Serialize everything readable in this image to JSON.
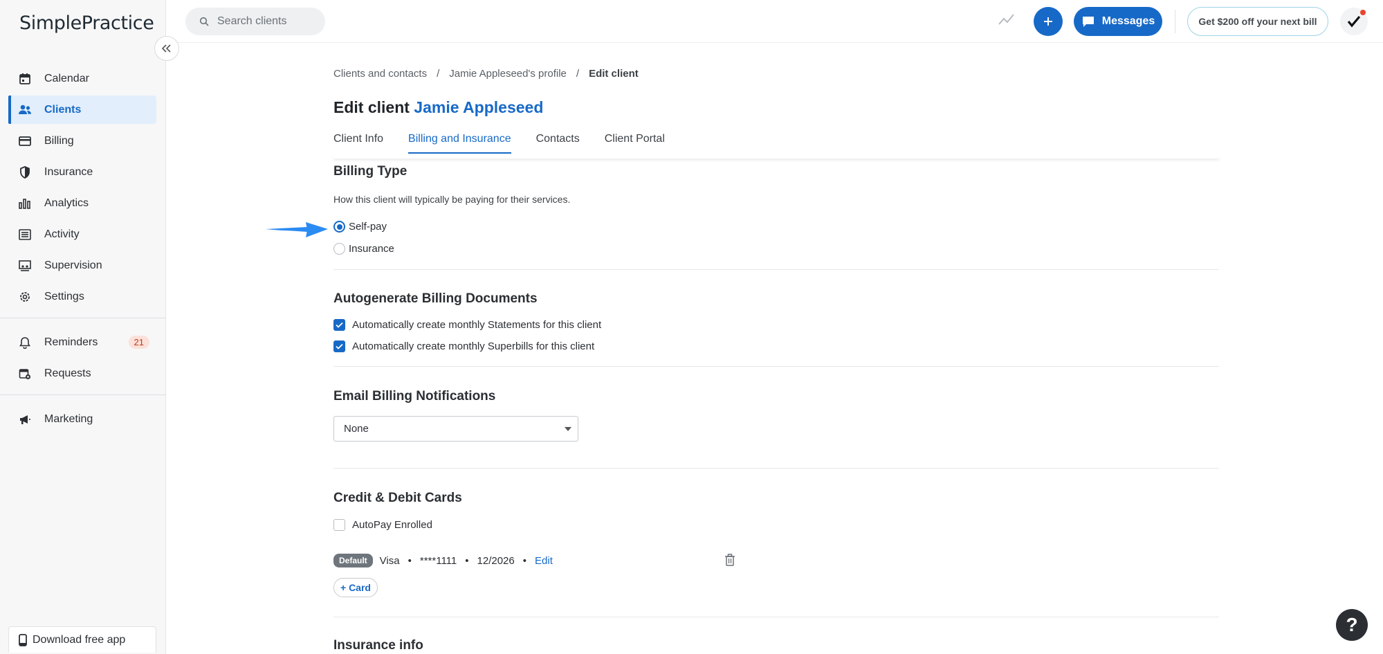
{
  "app": {
    "logo": "SimplePractice"
  },
  "sidebar": {
    "items": [
      {
        "label": "Calendar",
        "icon": "calendar-icon"
      },
      {
        "label": "Clients",
        "icon": "users-icon",
        "active": true
      },
      {
        "label": "Billing",
        "icon": "credit-card-icon"
      },
      {
        "label": "Insurance",
        "icon": "shield-icon"
      },
      {
        "label": "Analytics",
        "icon": "bar-chart-icon"
      },
      {
        "label": "Activity",
        "icon": "list-icon"
      },
      {
        "label": "Supervision",
        "icon": "supervision-icon"
      },
      {
        "label": "Settings",
        "icon": "gear-icon"
      }
    ],
    "secondary": [
      {
        "label": "Reminders",
        "icon": "bell-icon",
        "badge": "21"
      },
      {
        "label": "Requests",
        "icon": "calendar-plus-icon"
      }
    ],
    "tertiary": [
      {
        "label": "Marketing",
        "icon": "megaphone-icon"
      }
    ],
    "download_app": "Download free app"
  },
  "topbar": {
    "search_placeholder": "Search clients",
    "messages_label": "Messages",
    "promo_label": "Get $200 off your next bill"
  },
  "breadcrumb": {
    "items": [
      "Clients and contacts",
      "Jamie Appleseed's profile"
    ],
    "current": "Edit client"
  },
  "page": {
    "title_prefix": "Edit client",
    "client_name": "Jamie Appleseed"
  },
  "tabs": [
    {
      "label": "Client Info"
    },
    {
      "label": "Billing and Insurance",
      "active": true
    },
    {
      "label": "Contacts"
    },
    {
      "label": "Client Portal"
    }
  ],
  "billing_type": {
    "title": "Billing Type",
    "helper": "How this client will typically be paying for their services.",
    "options": [
      {
        "label": "Self-pay",
        "selected": true
      },
      {
        "label": "Insurance",
        "selected": false
      }
    ]
  },
  "autogenerate": {
    "title": "Autogenerate Billing Documents",
    "options": [
      {
        "label": "Automatically create monthly Statements for this client",
        "checked": true
      },
      {
        "label": "Automatically create monthly Superbills for this client",
        "checked": true
      }
    ]
  },
  "email_notifications": {
    "title": "Email Billing Notifications",
    "selected": "None"
  },
  "cards": {
    "title": "Credit & Debit Cards",
    "autopay_label": "AutoPay Enrolled",
    "autopay_checked": false,
    "card": {
      "badge": "Default",
      "brand": "Visa",
      "number": "****1111",
      "expiry": "12/2026",
      "edit_label": "Edit"
    },
    "add_card_label": "+ Card"
  },
  "insurance_info": {
    "title": "Insurance info"
  },
  "help": {
    "label": "?"
  },
  "colors": {
    "accent": "#1769c7",
    "active_nav_bg": "#e2eefb",
    "annotation_arrow": "#2a8bf2"
  }
}
